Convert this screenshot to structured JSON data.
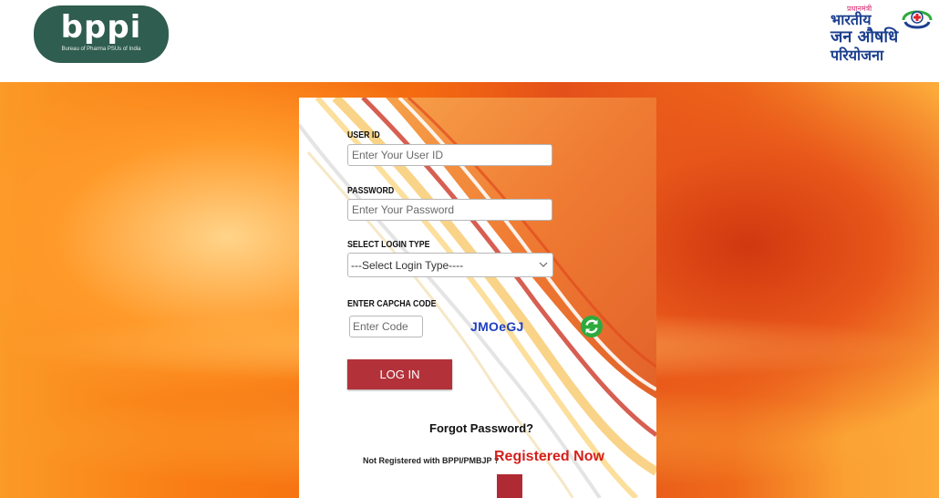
{
  "header": {
    "bppi_logo": {
      "mark": "bppi",
      "tagline": "Bureau of Pharma PSUs of India"
    },
    "pmbjp_logo": {
      "small": "प्रधानमंत्री",
      "line1": "भारतीय",
      "line2": "जन औषधि",
      "line3": "परियोजना"
    }
  },
  "login": {
    "user_id": {
      "label": "USER ID",
      "placeholder": "Enter Your User ID"
    },
    "password": {
      "label": "PASSWORD",
      "placeholder": "Enter Your Password"
    },
    "login_type": {
      "label": "SELECT LOGIN TYPE",
      "selected": "---Select Login Type----"
    },
    "captcha": {
      "label": "ENTER CAPCHA CODE",
      "placeholder": "Enter Code",
      "code": "JMOeGJ"
    },
    "login_button": "LOG IN",
    "forgot_password": "Forgot Password?",
    "register_prompt": "Not Registered with BPPI/PMBJP ?",
    "register_link": "Registered Now"
  },
  "icons": {
    "refresh": "refresh-icon",
    "chevron": "chevron-down-icon",
    "book": "book-icon"
  },
  "colors": {
    "brand_green": "#2f5d4f",
    "login_button": "#b3323a",
    "captcha_text": "#1f3fbf",
    "register_link": "#d4201c",
    "refresh_icon": "#2eaa3d"
  }
}
